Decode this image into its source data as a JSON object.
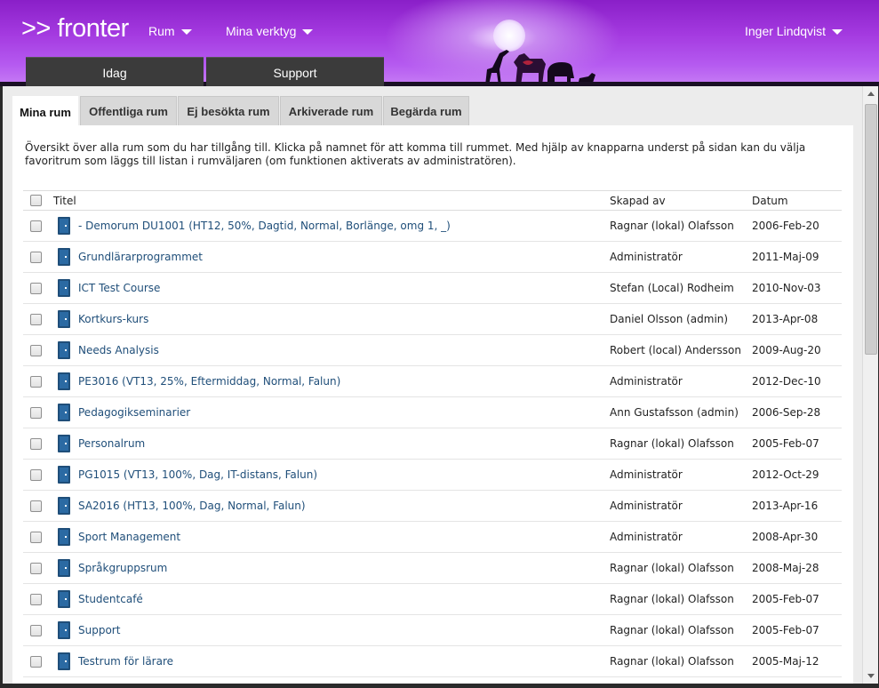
{
  "header": {
    "logo": ">> fronter",
    "nav": [
      {
        "label": "Rum"
      },
      {
        "label": "Mina verktyg"
      }
    ],
    "user": "Inger Lindqvist",
    "tabs": [
      {
        "label": "Idag"
      },
      {
        "label": "Support"
      }
    ]
  },
  "tabs": [
    {
      "label": "Mina rum",
      "active": true
    },
    {
      "label": "Offentliga rum"
    },
    {
      "label": "Ej besökta rum"
    },
    {
      "label": "Arkiverade rum"
    },
    {
      "label": "Begärda rum"
    }
  ],
  "intro": "Översikt över alla rum som du har tillgång till. Klicka på namnet för att komma till rummet. Med hjälp av knapparna underst på sidan kan du välja favoritrum som läggs till listan i rumväljaren (om funktionen aktiverats av administratören).",
  "table": {
    "columns": {
      "title": "Titel",
      "created_by": "Skapad av",
      "date": "Datum"
    },
    "rows": [
      {
        "title": "- Demorum DU1001 (HT12, 50%, Dagtid, Normal, Borlänge, omg 1, _)",
        "created_by": "Ragnar (lokal) Olafsson",
        "date": "2006-Feb-20"
      },
      {
        "title": "Grundlärarprogrammet",
        "created_by": "Administratör",
        "date": "2011-Maj-09"
      },
      {
        "title": "ICT Test Course",
        "created_by": "Stefan (Local) Rodheim",
        "date": "2010-Nov-03"
      },
      {
        "title": "Kortkurs-kurs",
        "created_by": "Daniel Olsson (admin)",
        "date": "2013-Apr-08"
      },
      {
        "title": "Needs Analysis",
        "created_by": "Robert (local) Andersson",
        "date": "2009-Aug-20"
      },
      {
        "title": "PE3016 (VT13, 25%, Eftermiddag, Normal, Falun)",
        "created_by": "Administratör",
        "date": "2012-Dec-10"
      },
      {
        "title": "Pedagogikseminarier",
        "created_by": "Ann Gustafsson (admin)",
        "date": "2006-Sep-28"
      },
      {
        "title": "Personalrum",
        "created_by": "Ragnar (lokal) Olafsson",
        "date": "2005-Feb-07"
      },
      {
        "title": "PG1015 (VT13, 100%, Dag, IT-distans, Falun)",
        "created_by": "Administratör",
        "date": "2012-Oct-29"
      },
      {
        "title": "SA2016 (HT13, 100%, Dag, Normal, Falun)",
        "created_by": "Administratör",
        "date": "2013-Apr-16"
      },
      {
        "title": "Sport Management",
        "created_by": "Administratör",
        "date": "2008-Apr-30"
      },
      {
        "title": "Språkgruppsrum",
        "created_by": "Ragnar (lokal) Olafsson",
        "date": "2008-Maj-28"
      },
      {
        "title": "Studentcafé",
        "created_by": "Ragnar (lokal) Olafsson",
        "date": "2005-Feb-07"
      },
      {
        "title": "Support",
        "created_by": "Ragnar (lokal) Olafsson",
        "date": "2005-Feb-07"
      },
      {
        "title": "Testrum för lärare",
        "created_by": "Ragnar (lokal) Olafsson",
        "date": "2005-Maj-12"
      }
    ]
  },
  "colors": {
    "header_purple": "#a43ae0",
    "link": "#1f4e79",
    "dark_tab": "#3b3b3b",
    "room_icon": "#1f4e79"
  }
}
